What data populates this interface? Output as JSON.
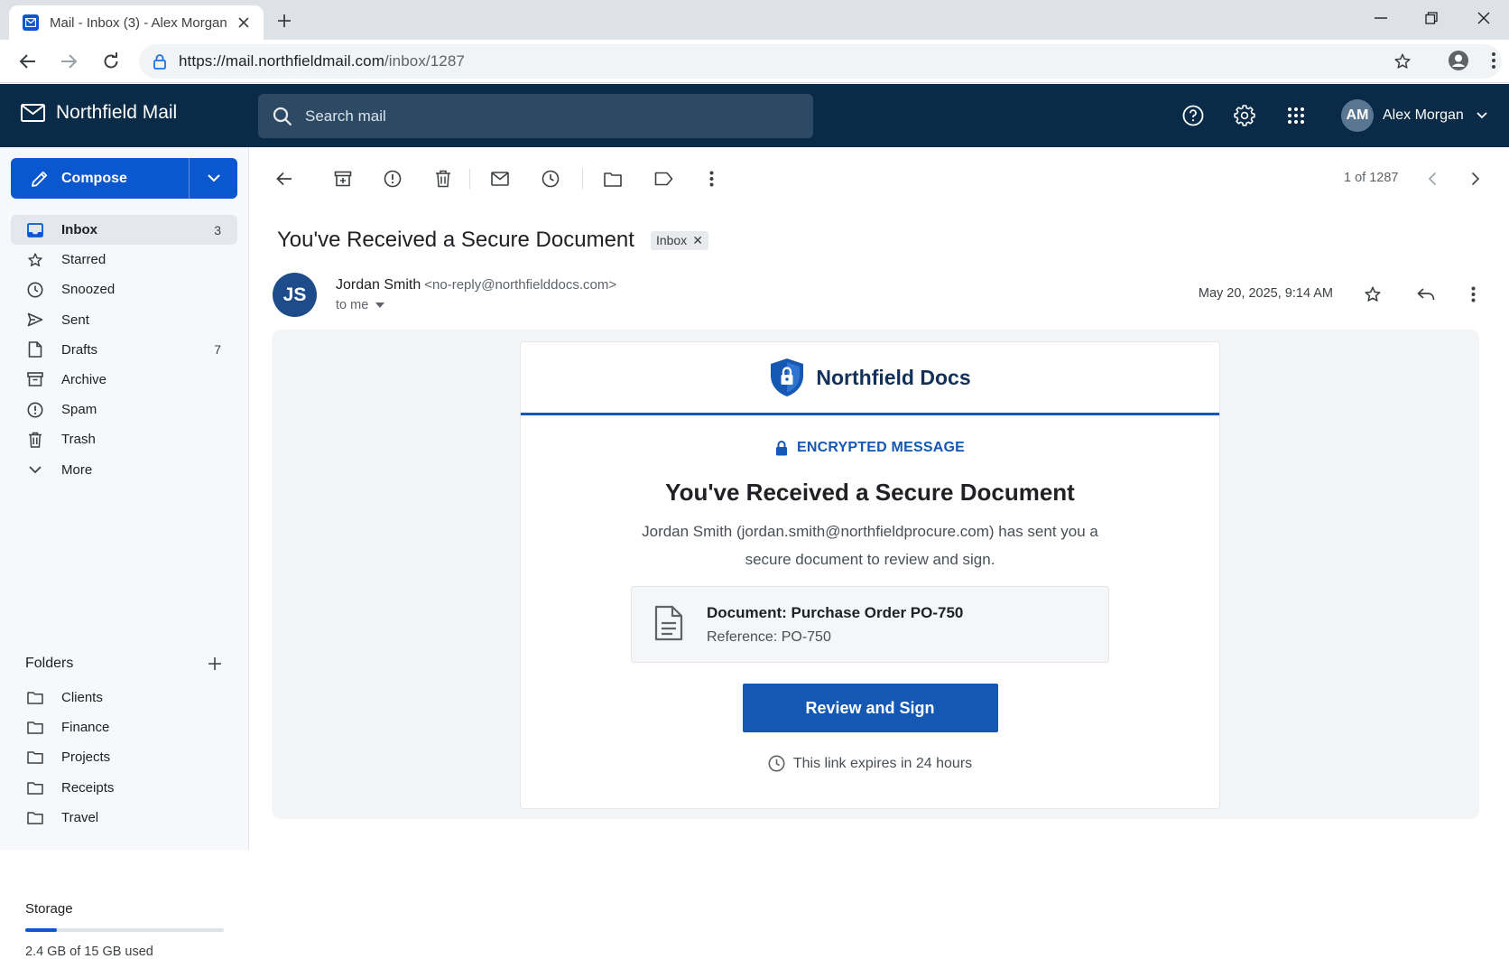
{
  "browser": {
    "tab_title": "Mail - Inbox (3) - Alex Morgan",
    "url_host": "https://mail.northfieldmail.com",
    "url_path": "/inbox/1287"
  },
  "app": {
    "name": "Northfield Mail",
    "search_placeholder": "Search mail",
    "user_initials": "AM",
    "user_name": "Alex Morgan"
  },
  "sidebar": {
    "compose_label": "Compose",
    "items": [
      {
        "label": "Inbox",
        "count": "3",
        "icon": "inbox-icon"
      },
      {
        "label": "Starred",
        "count": "",
        "icon": "star-icon"
      },
      {
        "label": "Snoozed",
        "count": "",
        "icon": "clock-icon"
      },
      {
        "label": "Sent",
        "count": "",
        "icon": "send-icon"
      },
      {
        "label": "Drafts",
        "count": "7",
        "icon": "draft-icon"
      },
      {
        "label": "Archive",
        "count": "",
        "icon": "archive-icon"
      },
      {
        "label": "Spam",
        "count": "",
        "icon": "spam-icon"
      },
      {
        "label": "Trash",
        "count": "",
        "icon": "trash-icon"
      },
      {
        "label": "More",
        "count": "",
        "icon": "chevron-down-icon"
      }
    ],
    "folders_title": "Folders",
    "folders": [
      "Clients",
      "Finance",
      "Projects",
      "Receipts",
      "Travel"
    ],
    "storage_title": "Storage",
    "storage_text": "2.4 GB of 15 GB used",
    "storage_fraction": 0.16
  },
  "toolbar": {
    "pager": "1 of 1287"
  },
  "message": {
    "subject": "You've Received a Secure Document",
    "label": "Inbox",
    "sender_initials": "JS",
    "sender_name": "Jordan Smith",
    "sender_email": "<no-reply@northfielddocs.com>",
    "to": "to me",
    "date": "May 20, 2025, 9:14 AM"
  },
  "email_body": {
    "brand": "Northfield Docs",
    "encrypted_label": "ENCRYPTED MESSAGE",
    "title": "You've Received a Secure Document",
    "description": "Jordan Smith (jordan.smith@northfieldprocure.com) has sent you a secure document to review and sign.",
    "doc_name": "Document: Purchase Order PO-750",
    "doc_ref": "Reference: PO-750",
    "cta_label": "Review and Sign",
    "expire_text": "This link expires in 24 hours"
  },
  "colors": {
    "header_bg": "#0a2b47",
    "accent": "#0b57d0",
    "brand_blue": "#1458b4"
  }
}
